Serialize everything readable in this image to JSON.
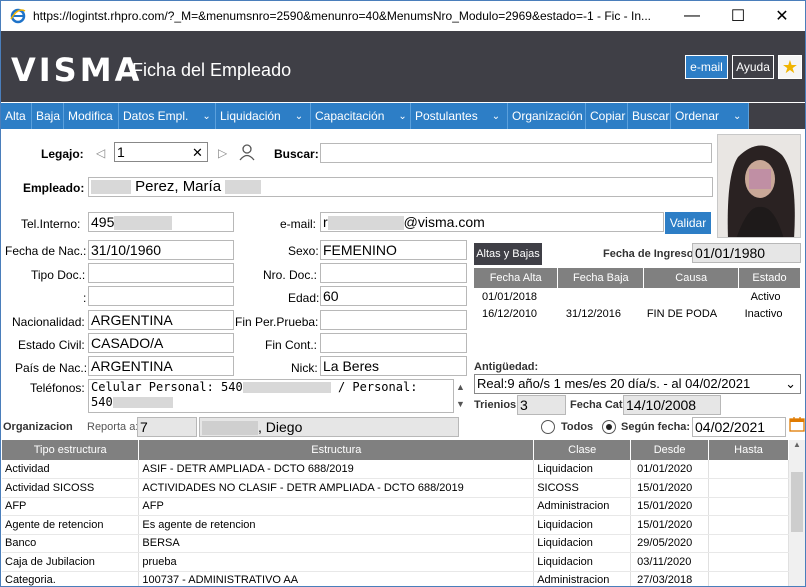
{
  "window": {
    "url": "https://logintst.rhpro.com/?_M=&menumsnro=2590&menunro=40&MenumsNro_Modulo=2969&estado=-1 - Fic - In...",
    "minimize": "—",
    "maximize": "☐",
    "close": "✕"
  },
  "header": {
    "logo": "VISMA",
    "title": "Ficha del Empleado",
    "email_btn": "e-mail",
    "help_btn": "Ayuda",
    "star_icon": "★"
  },
  "menu": {
    "items": [
      "Alta",
      "Baja",
      "Modifica",
      "Datos Empl.",
      "Liquidación",
      "Capacitación",
      "Postulantes",
      "Organización",
      "Copiar",
      "Buscar",
      "Ordenar"
    ],
    "chevron": "⌄"
  },
  "form": {
    "legajo_label": "Legajo:",
    "legajo_value": "1",
    "legajo_clear": "✕",
    "buscar_label": "Buscar:",
    "empleado_label": "Empleado:",
    "empleado_value": "Perez, María",
    "tel_label": "Tel.Interno:",
    "tel_value": "495",
    "email_label": "e-mail:",
    "email_prefix": "r",
    "email_domain": "@visma.com",
    "validar_btn": "Validar",
    "fnac_label": "Fecha de Nac.:",
    "fnac_value": "31/10/1960",
    "sexo_label": "Sexo:",
    "sexo_value": "FEMENINO",
    "tipodoc_label": "Tipo Doc.:",
    "nrodoc_label": "Nro. Doc.:",
    "colon_label": ":",
    "edad_label": "Edad:",
    "edad_value": "60",
    "nacionalidad_label": "Nacionalidad:",
    "nacionalidad_value": "ARGENTINA",
    "finprueba_label": "Fin Per.Prueba:",
    "estcivil_label": "Estado Civil:",
    "estcivil_value": "CASADO/A",
    "fincont_label": "Fin Cont.:",
    "paisnac_label": "País de Nac.:",
    "paisnac_value": "ARGENTINA",
    "nick_label": "Nick:",
    "nick_value": "La Beres",
    "telefonos_label": "Teléfonos:",
    "telefonos_line1a": "Celular Personal: 540",
    "telefonos_line1b": "/ Personal:",
    "telefonos_line2": "540"
  },
  "altas": {
    "btn": "Altas y Bajas",
    "ingreso_label": "Fecha de Ingreso:",
    "ingreso_value": "01/01/1980",
    "columns": [
      "Fecha Alta",
      "Fecha Baja",
      "Causa",
      "Estado"
    ],
    "rows": [
      [
        "01/01/2018",
        "",
        "",
        "Activo"
      ],
      [
        "16/12/2010",
        "31/12/2016",
        "FIN DE PODA",
        "Inactivo"
      ]
    ]
  },
  "antiguedad": {
    "label": "Antigüedad:",
    "value": "Real:9 año/s 1 mes/es 20 día/s. - al 04/02/2021",
    "trienios_label": "Trienios:",
    "trienios_value": "3",
    "fechacat_label": "Fecha Cat:",
    "fechacat_value": "14/10/2008"
  },
  "organizacion": {
    "label": "Organizacion",
    "reporta_label": "Reporta a:",
    "reporta_num": "7",
    "reporta_name": ", Diego",
    "todos_label": "Todos",
    "segun_label": "Según fecha:",
    "segun_value": "04/02/2021"
  },
  "estructura": {
    "columns": [
      "Tipo estructura",
      "Estructura",
      "Clase",
      "Desde",
      "Hasta"
    ],
    "rows": [
      [
        "Actividad",
        "ASIF - DETR AMPLIADA - DCTO 688/2019",
        "Liquidacion",
        "01/01/2020",
        ""
      ],
      [
        "Actividad SICOSS",
        "ACTIVIDADES NO CLASIF - DETR AMPLIADA - DCTO 688/2019",
        "SICOSS",
        "15/01/2020",
        ""
      ],
      [
        "AFP",
        "AFP",
        "Administracion",
        "15/01/2020",
        ""
      ],
      [
        "Agente de retencion",
        "Es agente de retencion",
        "Liquidacion",
        "15/01/2020",
        ""
      ],
      [
        "Banco",
        "BERSA",
        "Liquidacion",
        "29/05/2020",
        ""
      ],
      [
        "Caja de Jubilacion",
        "prueba",
        "Liquidacion",
        "03/11/2020",
        ""
      ],
      [
        "Categoria.",
        "100737 - ADMINISTRATIVO AA",
        "Administracion",
        "27/03/2018",
        ""
      ]
    ]
  }
}
